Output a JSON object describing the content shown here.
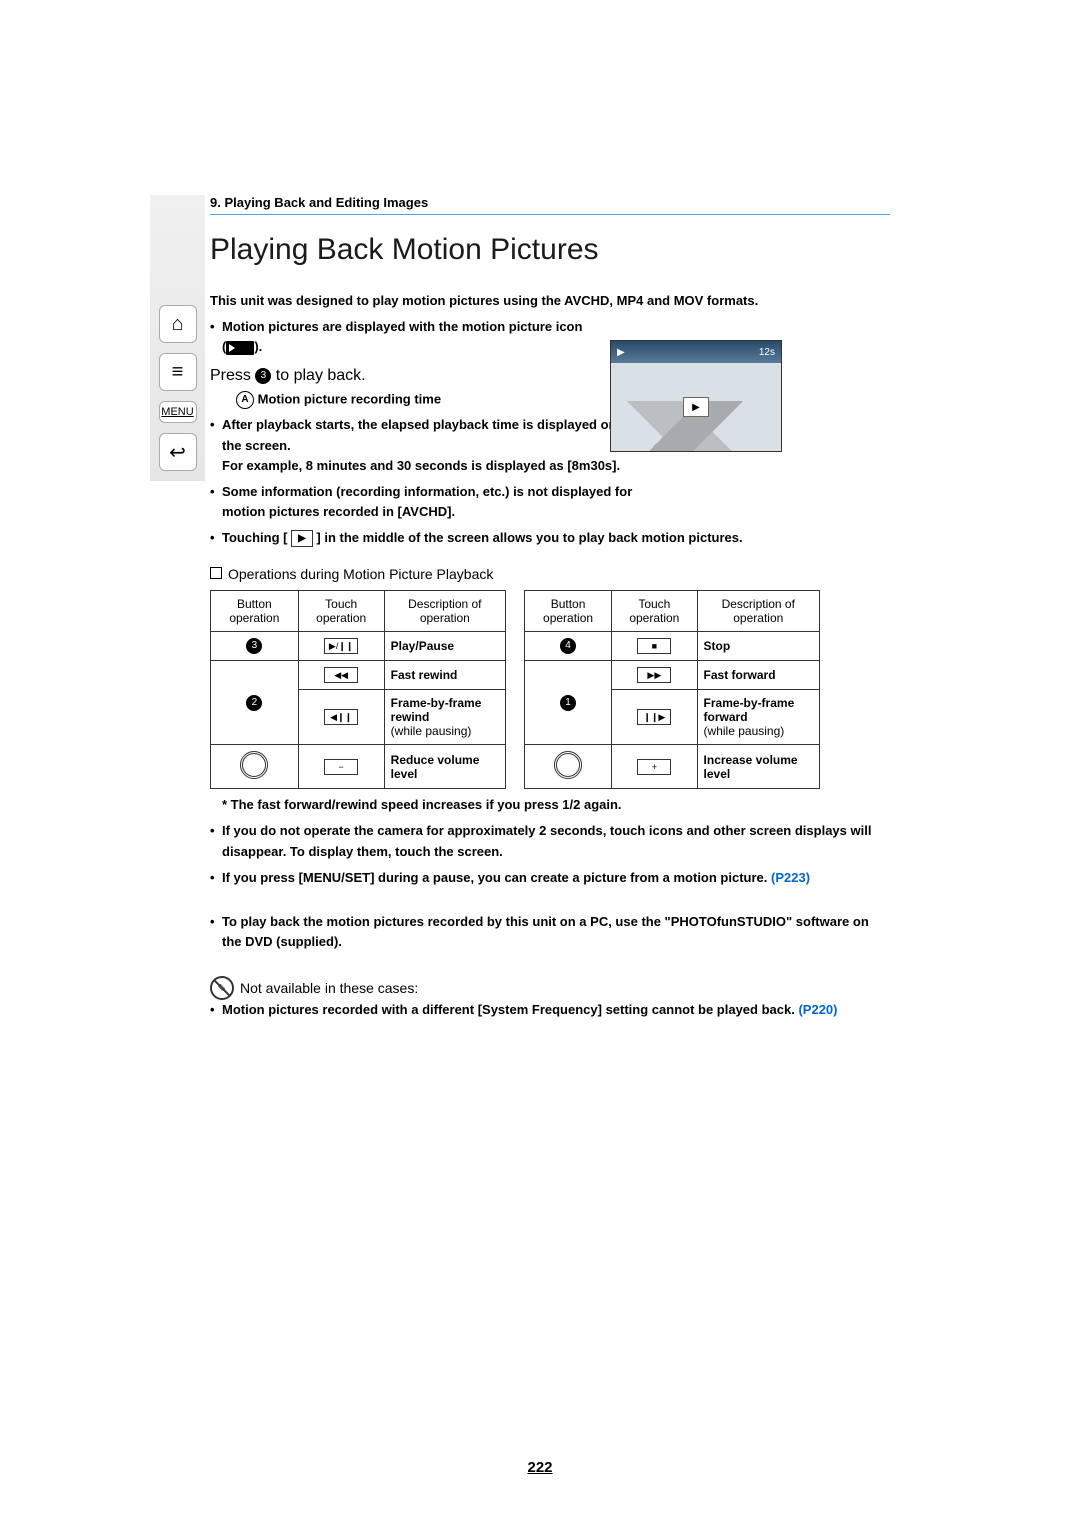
{
  "chapter": "9. Playing Back and Editing Images",
  "title": "Playing Back Motion Pictures",
  "intro": "This unit was designed to play motion pictures using the AVCHD, MP4 and MOV formats.",
  "bullet_icon_line": "Motion pictures are displayed with the motion picture icon",
  "icon_suffix": "([        ]).",
  "press_prefix": "Press ",
  "press_circle": "3",
  "press_suffix": " to play back.",
  "caption_a_label": "A",
  "caption_a_text": "Motion picture recording time",
  "after_playback": "After playback starts, the elapsed playback time is displayed on the screen.",
  "after_playback2": "For example, 8 minutes and 30 seconds is displayed as [8m30s].",
  "info_not_displayed": "Some information (recording information, etc.) is not displayed for motion pictures recorded in [AVCHD].",
  "touching_prefix": "Touching [",
  "touching_mid": "▶",
  "touching_suffix": "] in the middle of the screen allows you to play back motion pictures.",
  "thumb_time": "12s",
  "section_heading": "Operations during Motion Picture Playback",
  "table_headers": {
    "button": "Button operation",
    "touch": "Touch operation",
    "desc": "Description of operation"
  },
  "left_table": [
    {
      "button_circle": "3",
      "touch": "▶/❙❙",
      "desc": "Play/Pause",
      "bold": true
    },
    {
      "button_circle": "2",
      "touch": "◀◀",
      "desc": "Fast rewind",
      "bold": true,
      "rowspan": 2
    },
    {
      "touch": "◀❙❙",
      "desc": "Frame-by-frame rewind\n(while pausing)",
      "bold_first": "Frame-by-frame rewind"
    },
    {
      "button_dial": "left",
      "touch": "−",
      "desc": "Reduce volume level",
      "bold": true
    }
  ],
  "right_table": [
    {
      "button_circle": "4",
      "touch": "■",
      "desc": "Stop",
      "bold": true
    },
    {
      "button_circle": "1",
      "touch": "▶▶",
      "desc": "Fast forward",
      "bold": true,
      "rowspan": 2
    },
    {
      "touch": "❙❙▶",
      "desc": "Frame-by-frame forward\n(while pausing)",
      "bold_first": "Frame-by-frame forward"
    },
    {
      "button_dial": "right",
      "touch": "+",
      "desc": "Increase volume level",
      "bold": true
    }
  ],
  "footnote_speed": "The fast forward/rewind speed increases if you press 1/2 again.",
  "footnote_disappear": "If you do not operate the camera for approximately 2 seconds, touch icons and other screen displays will disappear. To display them, touch the screen.",
  "footnote_menuset": "If you press [MENU/SET] during a pause, you can create a picture from a motion picture.",
  "link1": "(P223)",
  "footnote_pc": "To play back the motion pictures recorded by this unit on a PC, use the \"PHOTOfunSTUDIO\" software on the DVD (supplied).",
  "not_available_heading": "Not available in these cases:",
  "not_available_text": "Motion pictures recorded with a different [System Frequency] setting cannot be played back.",
  "link2": "(P220)",
  "page_number": "222",
  "nav": {
    "home": "⌂",
    "list": "≡",
    "menu": "MENU",
    "back": "↩"
  }
}
